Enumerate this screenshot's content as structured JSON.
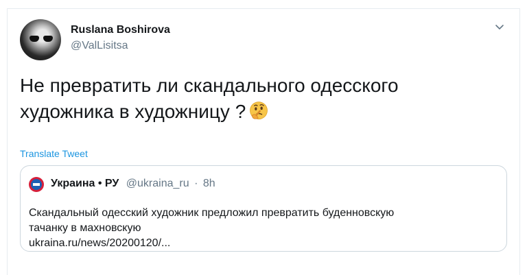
{
  "author": {
    "name": "Ruslana Boshirova",
    "handle": "@ValLisitsa"
  },
  "tweet": {
    "text": "Не превратить ли скандального одесского художника в художницу ?",
    "emoji_icon": "thinking-face-icon",
    "translate_label": "Translate Tweet"
  },
  "quoted_tweet": {
    "name": "Украина • РУ",
    "handle": "@ukraina_ru",
    "separator": "·",
    "time": "8h",
    "text_line1": "Скандальный одесский художник предложил превратить буденновскую",
    "text_line2": "тачанку в махновскую",
    "link": "ukraina.ru/news/20200120/..."
  },
  "colors": {
    "link": "#1b95e0",
    "secondary_text": "#657786",
    "border": "#ccd6dd"
  }
}
